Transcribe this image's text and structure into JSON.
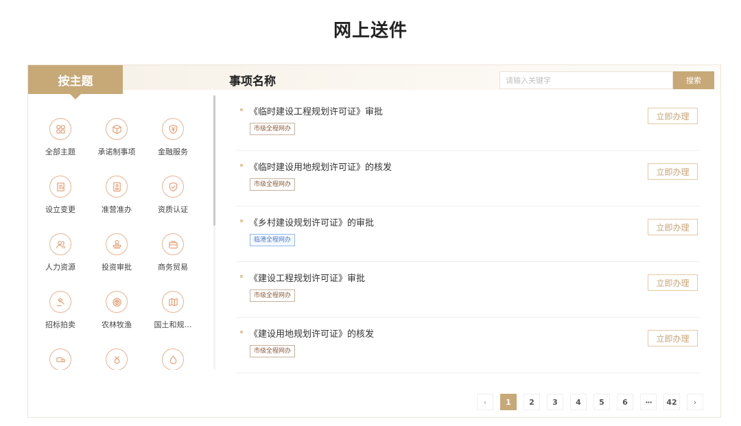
{
  "page": {
    "title": "网上送件"
  },
  "header": {
    "theme_tab": "按主题",
    "column_title": "事项名称",
    "search": {
      "placeholder": "请输入关键字",
      "value": "",
      "button": "搜索"
    }
  },
  "categories": [
    {
      "label": "全部主题",
      "icon": "grid-icon"
    },
    {
      "label": "承诺制事项",
      "icon": "cube-icon"
    },
    {
      "label": "金融服务",
      "icon": "yuan-shield-icon"
    },
    {
      "label": "设立变更",
      "icon": "document-edit-icon"
    },
    {
      "label": "准营准办",
      "icon": "license-icon"
    },
    {
      "label": "资质认证",
      "icon": "shield-check-icon"
    },
    {
      "label": "人力资源",
      "icon": "people-icon"
    },
    {
      "label": "投资审批",
      "icon": "stamp-icon"
    },
    {
      "label": "商务贸易",
      "icon": "briefcase-icon"
    },
    {
      "label": "招标拍卖",
      "icon": "gavel-icon"
    },
    {
      "label": "农林牧渔",
      "icon": "leaf-icon"
    },
    {
      "label": "国土和规…",
      "icon": "map-icon"
    },
    {
      "label": "",
      "icon": "truck-icon"
    },
    {
      "label": "",
      "icon": "badge-icon"
    },
    {
      "label": "",
      "icon": "drop-icon"
    }
  ],
  "items": [
    {
      "title": "《临时建设工程规划许可证》审批",
      "tag": "市级全程网办",
      "tag_color": "brown",
      "action": "立即办理"
    },
    {
      "title": "《临时建设用地规划许可证》的核发",
      "tag": "市级全程网办",
      "tag_color": "brown",
      "action": "立即办理"
    },
    {
      "title": "《乡村建设规划许可证》的审批",
      "tag": "临港全程网办",
      "tag_color": "blue",
      "action": "立即办理"
    },
    {
      "title": "《建设工程规划许可证》审批",
      "tag": "市级全程网办",
      "tag_color": "brown",
      "action": "立即办理"
    },
    {
      "title": "《建设用地规划许可证》的核发",
      "tag": "市级全程网办",
      "tag_color": "brown",
      "action": "立即办理"
    }
  ],
  "pagination": {
    "prev": "‹",
    "next": "›",
    "pages": [
      "1",
      "2",
      "3",
      "4",
      "5",
      "6",
      "···",
      "42"
    ],
    "current": "1"
  },
  "colors": {
    "accent": "#c7a877",
    "icon_border": "#eab291",
    "tag_blue": "#4b7cc4"
  }
}
